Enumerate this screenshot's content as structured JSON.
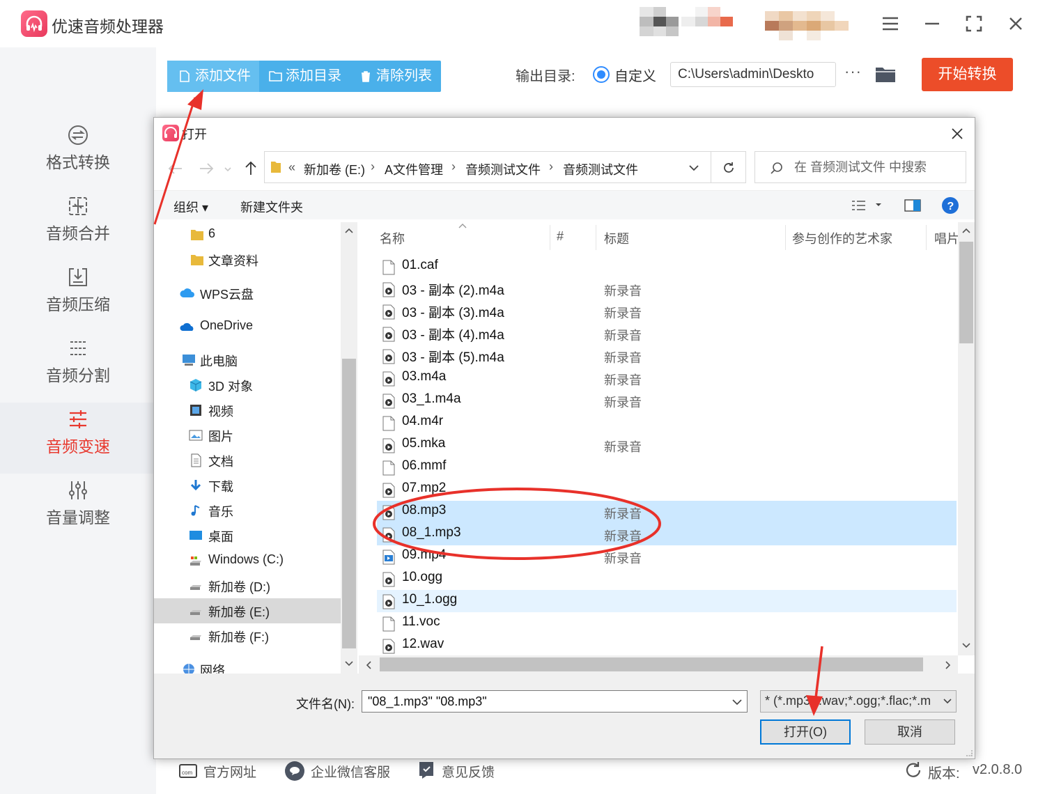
{
  "app": {
    "title": "优速音频处理器"
  },
  "sidebar": {
    "items": [
      {
        "label": "格式转换",
        "icon": "convert-icon"
      },
      {
        "label": "音频合并",
        "icon": "merge-icon"
      },
      {
        "label": "音频压缩",
        "icon": "compress-icon"
      },
      {
        "label": "音频分割",
        "icon": "split-icon"
      },
      {
        "label": "音频变速",
        "icon": "speed-icon",
        "active": true
      },
      {
        "label": "音量调整",
        "icon": "volume-icon"
      }
    ]
  },
  "toolbar": {
    "add_file": "添加文件",
    "add_dir": "添加目录",
    "clear_list": "清除列表",
    "output_label": "输出目录:",
    "custom_label": "自定义",
    "output_path": "C:\\Users\\admin\\Deskto",
    "more": "···",
    "start": "开始转换"
  },
  "footer": {
    "website": "官方网址",
    "wechat": "企业微信客服",
    "feedback": "意见反馈",
    "version_label": "版本:",
    "version_value": "v2.0.8.0"
  },
  "dialog": {
    "title": "打开",
    "address": {
      "lead": "«",
      "crumbs": [
        "新加卷 (E:)",
        "A文件管理",
        "音频测试文件",
        "音频测试文件"
      ]
    },
    "search_placeholder": "在 音频测试文件 中搜索",
    "commands": {
      "organize": "组织 ▾",
      "new_folder": "新建文件夹"
    },
    "nav": [
      {
        "label": "6",
        "icon": "folder-icon"
      },
      {
        "label": "文章资料",
        "icon": "folder-icon"
      },
      {
        "label": "WPS云盘",
        "icon": "cloud-icon"
      },
      {
        "label": "OneDrive",
        "icon": "onedrive-icon"
      },
      {
        "label": "此电脑",
        "icon": "computer-icon"
      },
      {
        "label": "3D 对象",
        "icon": "3d-objects-icon"
      },
      {
        "label": "视频",
        "icon": "video-icon"
      },
      {
        "label": "图片",
        "icon": "pictures-icon"
      },
      {
        "label": "文档",
        "icon": "documents-icon"
      },
      {
        "label": "下载",
        "icon": "download-icon"
      },
      {
        "label": "音乐",
        "icon": "music-icon"
      },
      {
        "label": "桌面",
        "icon": "desktop-icon"
      },
      {
        "label": "Windows (C:)",
        "icon": "drive-icon"
      },
      {
        "label": "新加卷 (D:)",
        "icon": "drive-icon"
      },
      {
        "label": "新加卷 (E:)",
        "icon": "drive-icon",
        "selected": true
      },
      {
        "label": "新加卷 (F:)",
        "icon": "drive-icon"
      },
      {
        "label": "网络",
        "icon": "network-icon"
      }
    ],
    "columns": [
      "名称",
      "#",
      "标题",
      "参与创作的艺术家",
      "唱片"
    ],
    "files": [
      {
        "name": "01.caf",
        "title": "",
        "kind": "blank"
      },
      {
        "name": "03 - 副本 (2).m4a",
        "title": "新录音",
        "kind": "media"
      },
      {
        "name": "03 - 副本 (3).m4a",
        "title": "新录音",
        "kind": "media"
      },
      {
        "name": "03 - 副本 (4).m4a",
        "title": "新录音",
        "kind": "media"
      },
      {
        "name": "03 - 副本 (5).m4a",
        "title": "新录音",
        "kind": "media"
      },
      {
        "name": "03.m4a",
        "title": "新录音",
        "kind": "media"
      },
      {
        "name": "03_1.m4a",
        "title": "新录音",
        "kind": "media"
      },
      {
        "name": "04.m4r",
        "title": "",
        "kind": "blank"
      },
      {
        "name": "05.mka",
        "title": "新录音",
        "kind": "media"
      },
      {
        "name": "06.mmf",
        "title": "",
        "kind": "blank"
      },
      {
        "name": "07.mp2",
        "title": "",
        "kind": "media"
      },
      {
        "name": "08.mp3",
        "title": "新录音",
        "kind": "media",
        "state": "selected"
      },
      {
        "name": "08_1.mp3",
        "title": "新录音",
        "kind": "media",
        "state": "selected"
      },
      {
        "name": "09.mp4",
        "title": "新录音",
        "kind": "video"
      },
      {
        "name": "10.ogg",
        "title": "",
        "kind": "media"
      },
      {
        "name": "10_1.ogg",
        "title": "",
        "kind": "media",
        "state": "hover"
      },
      {
        "name": "11.voc",
        "title": "",
        "kind": "blank"
      },
      {
        "name": "12.wav",
        "title": "",
        "kind": "media"
      }
    ],
    "filename_label": "文件名(N):",
    "filename_value": "\"08_1.mp3\" \"08.mp3\"",
    "filter": "* (*.mp3;*.wav;*.ogg;*.flac;*.m",
    "open_button": "打开(O)",
    "cancel_button": "取消"
  },
  "annotation_color": "#e8312a"
}
